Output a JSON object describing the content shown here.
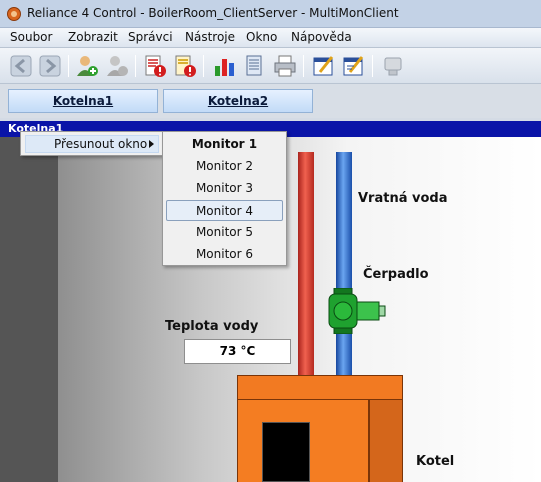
{
  "window": {
    "title": "Reliance 4 Control - BoilerRoom_ClientServer - MultiMonClient"
  },
  "menubar": {
    "items": [
      {
        "label": "Soubor"
      },
      {
        "label": "Zobrazit"
      },
      {
        "label": "Správci"
      },
      {
        "label": "Nástroje"
      },
      {
        "label": "Okno"
      },
      {
        "label": "Nápověda"
      }
    ]
  },
  "toolbar": {
    "icons": [
      "back-arrow-icon",
      "forward-arrow-icon",
      "add-user-icon",
      "remove-user-icon",
      "alarm-list-icon",
      "alarm-history-icon",
      "bar-chart-icon",
      "database-icon",
      "print-icon",
      "edit-window-icon",
      "edit-window-2-icon",
      "disconnect-icon"
    ]
  },
  "tabs": [
    {
      "label": "Kotelna1"
    },
    {
      "label": "Kotelna2"
    }
  ],
  "subwindow": {
    "caption": "Kotelna1"
  },
  "scene": {
    "label_return_water": "Vratná voda",
    "label_pump": "Čerpadlo",
    "label_temperature": "Teplota vody",
    "temperature_value": "73 °C",
    "label_boiler": "Kotel"
  },
  "context_menu": {
    "item_label": "Přesunout okno"
  },
  "submenu": {
    "items": [
      {
        "label": "Monitor 1",
        "bold": true
      },
      {
        "label": "Monitor 2"
      },
      {
        "label": "Monitor 3"
      },
      {
        "label": "Monitor 4",
        "highlighted": true
      },
      {
        "label": "Monitor 5"
      },
      {
        "label": "Monitor 6"
      }
    ]
  },
  "colors": {
    "caption_bar": "#0a14a8",
    "pipe_hot": "#e0463a",
    "pipe_cold": "#2f6fd0",
    "boiler": "#f47d22",
    "pump": "#1c9a2c"
  }
}
